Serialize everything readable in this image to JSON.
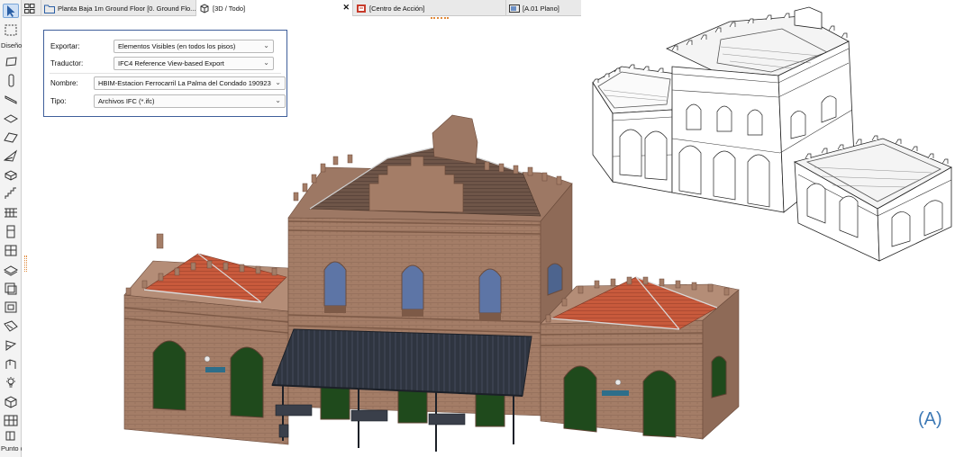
{
  "toolbox": {
    "section_label": "Diseño",
    "bottom_label": "Punto c",
    "tools": [
      "arrow-icon",
      "marquee-icon",
      "wall-icon",
      "column-icon",
      "beam-icon",
      "slab-icon",
      "roof-icon",
      "shell-icon",
      "morph-icon",
      "stair-icon",
      "railing-icon",
      "curtain-wall-icon",
      "door-icon",
      "window-icon",
      "skylight-icon",
      "object-icon",
      "zone-icon",
      "mesh-icon",
      "lamp-icon",
      "camera-icon",
      "section-icon",
      "grid-icon",
      "wall-end-icon"
    ]
  },
  "tabs": [
    {
      "label": "Planta Baja 1m Ground Floor [0. Ground Flo...",
      "icon": "floor-plan-icon"
    },
    {
      "label": "[3D / Todo]",
      "icon": "3d-cube-icon",
      "active": true
    },
    {
      "label": "[Centro de Acción]",
      "icon": "action-center-icon"
    },
    {
      "label": "[A.01 Plano]",
      "icon": "layout-icon"
    }
  ],
  "dialog": {
    "exportar_label": "Exportar:",
    "exportar_value": "Elementos Visibles (en todos los pisos)",
    "traductor_label": "Traductor:",
    "traductor_value": "IFC4 Reference View-based Export",
    "nombre_label": "Nombre:",
    "nombre_value": "HBIM-Estacion Ferrocarril La Palma del Condado 190923",
    "tipo_label": "Tipo:",
    "tipo_value": "Archivos IFC (*.ifc)"
  },
  "figure_tag": "(A)",
  "colors": {
    "brick": "#a47d67",
    "brick_dark": "#7d5a47",
    "roof_red": "#c85a3c",
    "roof_brown": "#6e5548",
    "canopy": "#2f3540",
    "door_green": "#1f4a1c",
    "window_blue": "#5d75a6",
    "accent_blue": "#3c78b5"
  }
}
